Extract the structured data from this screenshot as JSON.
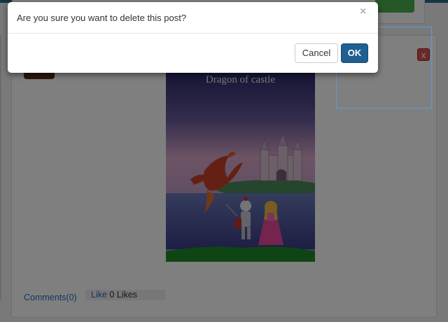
{
  "post": {
    "image_title": "Dragon of castle",
    "delete_label": "x"
  },
  "footer": {
    "comments_label": "Comments(0)",
    "like_label": "Like",
    "likes_count": "0 Likes"
  },
  "modal": {
    "message": "Are you sure you want to delete this post?",
    "close_symbol": "×",
    "cancel_label": "Cancel",
    "ok_label": "OK"
  },
  "colors": {
    "primary": "#1f5f91",
    "danger": "#d9534f",
    "link": "#2a6ebb",
    "success": "#4cae4c"
  }
}
